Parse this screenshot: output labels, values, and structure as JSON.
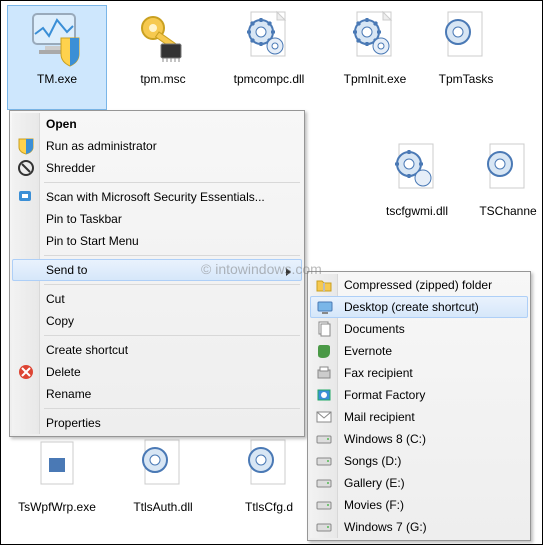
{
  "files_row1": [
    {
      "label": "TM.exe",
      "kind": "exe",
      "selected": true
    },
    {
      "label": "tpm.msc",
      "kind": "key"
    },
    {
      "label": "tpmcompc.dll",
      "kind": "gear"
    },
    {
      "label": "TpmInit.exe",
      "kind": "gear"
    },
    {
      "label": "TpmTasks"
    }
  ],
  "files_row2_labels": [
    {
      "label": "tscfgwmi.dll",
      "kind": "gear"
    },
    {
      "label": "TSChanne"
    }
  ],
  "files_row3": [
    {
      "label": "TsWpfWrp.exe"
    },
    {
      "label": "TtlsAuth.dll"
    },
    {
      "label": "TtlsCfg.d"
    }
  ],
  "context_menu": {
    "open": "Open",
    "runas": "Run as administrator",
    "shredder": "Shredder",
    "scan": "Scan with Microsoft Security Essentials...",
    "pin_taskbar": "Pin to Taskbar",
    "pin_start": "Pin to Start Menu",
    "sendto": "Send to",
    "cut": "Cut",
    "copy": "Copy",
    "create_shortcut": "Create shortcut",
    "delete": "Delete",
    "rename": "Rename",
    "properties": "Properties"
  },
  "sendto_menu": {
    "compressed": "Compressed (zipped) folder",
    "desktop": "Desktop (create shortcut)",
    "documents": "Documents",
    "evernote": "Evernote",
    "fax": "Fax recipient",
    "format": "Format Factory",
    "mail": "Mail recipient",
    "win8": "Windows 8 (C:)",
    "songs": "Songs (D:)",
    "gallery": "Gallery (E:)",
    "movies": "Movies (F:)",
    "win7": "Windows 7 (G:)"
  },
  "watermark": "© intowindows.com"
}
